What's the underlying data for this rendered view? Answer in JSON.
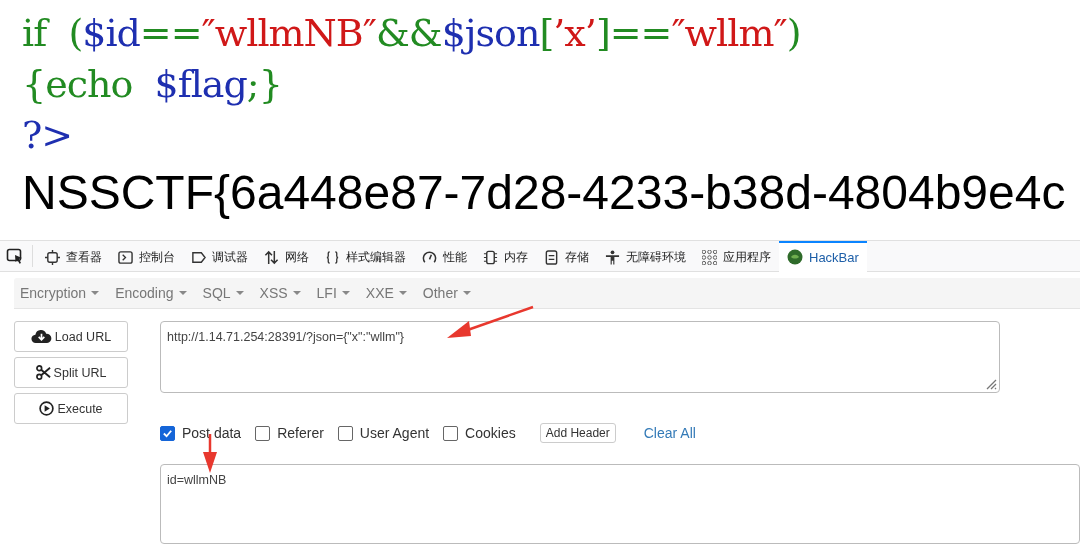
{
  "code": {
    "lines": [
      [
        {
          "kind": "plain",
          "text": "if  ("
        },
        {
          "kind": "var",
          "text": "$id"
        },
        {
          "kind": "plain",
          "text": "=="
        },
        {
          "kind": "string",
          "text": "″wllmNB″"
        },
        {
          "kind": "plain",
          "text": "&&"
        },
        {
          "kind": "var",
          "text": "$json"
        },
        {
          "kind": "plain",
          "text": "["
        },
        {
          "kind": "string",
          "text": "’x’"
        },
        {
          "kind": "plain",
          "text": "]=="
        },
        {
          "kind": "string",
          "text": "″wllm″"
        },
        {
          "kind": "plain",
          "text": ")"
        }
      ],
      [
        {
          "kind": "plain",
          "text": "{echo  "
        },
        {
          "kind": "var",
          "text": "$flag"
        },
        {
          "kind": "plain",
          "text": ";}"
        }
      ],
      [
        {
          "kind": "var",
          "text": "?>"
        }
      ]
    ]
  },
  "output": "NSSCTF{6a448e87-7d28-4233-b38d-4804b9e4c",
  "devtools": {
    "tabs": [
      {
        "label": "查看器",
        "kind": "inspector",
        "selected": false
      },
      {
        "label": "控制台",
        "kind": "console",
        "selected": false
      },
      {
        "label": "调试器",
        "kind": "debugger",
        "selected": false
      },
      {
        "label": "网络",
        "kind": "network",
        "selected": false
      },
      {
        "label": "样式编辑器",
        "kind": "style",
        "selected": false
      },
      {
        "label": "性能",
        "kind": "performance",
        "selected": false
      },
      {
        "label": "内存",
        "kind": "memory",
        "selected": false
      },
      {
        "label": "存储",
        "kind": "storage",
        "selected": false
      },
      {
        "label": "无障碍环境",
        "kind": "accessibility",
        "selected": false
      },
      {
        "label": "应用程序",
        "kind": "application",
        "selected": false
      },
      {
        "label": "HackBar",
        "kind": "hackbar",
        "selected": true
      }
    ]
  },
  "hackbar": {
    "menus": [
      "Encryption",
      "Encoding",
      "SQL",
      "XSS",
      "LFI",
      "XXE",
      "Other"
    ],
    "actions": [
      {
        "label": "Load URL",
        "kind": "load"
      },
      {
        "label": "Split URL",
        "kind": "split"
      },
      {
        "label": "Execute",
        "kind": "execute"
      }
    ],
    "url": "http://1.14.71.254:28391/?json={\"x\":\"wllm\"}",
    "options": [
      {
        "label": "Post data",
        "checked": true
      },
      {
        "label": "Referer",
        "checked": false
      },
      {
        "label": "User Agent",
        "checked": false
      },
      {
        "label": "Cookies",
        "checked": false
      }
    ],
    "add_header": "Add Header",
    "clear_all": "Clear All",
    "post_body": "id=wllmNB"
  }
}
